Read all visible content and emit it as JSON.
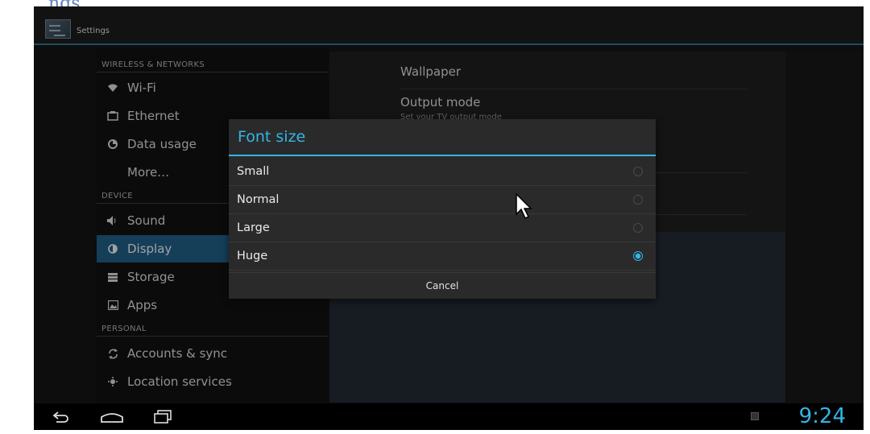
{
  "page_fragment": "ngs",
  "app": {
    "title": "Settings"
  },
  "sections": [
    {
      "header": "WIRELESS & NETWORKS",
      "items": [
        {
          "label": "Wi-Fi",
          "icon": "wifi-icon"
        },
        {
          "label": "Ethernet",
          "icon": "ethernet-icon"
        },
        {
          "label": "Data usage",
          "icon": "data-usage-icon"
        },
        {
          "label": "More…",
          "icon": ""
        }
      ]
    },
    {
      "header": "DEVICE",
      "items": [
        {
          "label": "Sound",
          "icon": "speaker-icon"
        },
        {
          "label": "Display",
          "icon": "display-icon",
          "selected": true
        },
        {
          "label": "Storage",
          "icon": "storage-icon"
        },
        {
          "label": "Apps",
          "icon": "apps-icon"
        }
      ]
    },
    {
      "header": "PERSONAL",
      "items": [
        {
          "label": "Accounts & sync",
          "icon": "sync-icon"
        },
        {
          "label": "Location services",
          "icon": "location-icon"
        }
      ]
    }
  ],
  "display_settings": [
    {
      "title": "Wallpaper",
      "subtitle": ""
    },
    {
      "title": "Output mode",
      "subtitle": "Set your TV output mode"
    }
  ],
  "dialog": {
    "title": "Font size",
    "options": [
      {
        "label": "Small",
        "checked": false
      },
      {
        "label": "Normal",
        "checked": false
      },
      {
        "label": "Large",
        "checked": false
      },
      {
        "label": "Huge",
        "checked": true
      }
    ],
    "cancel_label": "Cancel"
  },
  "status": {
    "time": "9:24"
  },
  "colors": {
    "accent": "#33b5e5",
    "selected_bg": "#1f5a80"
  }
}
